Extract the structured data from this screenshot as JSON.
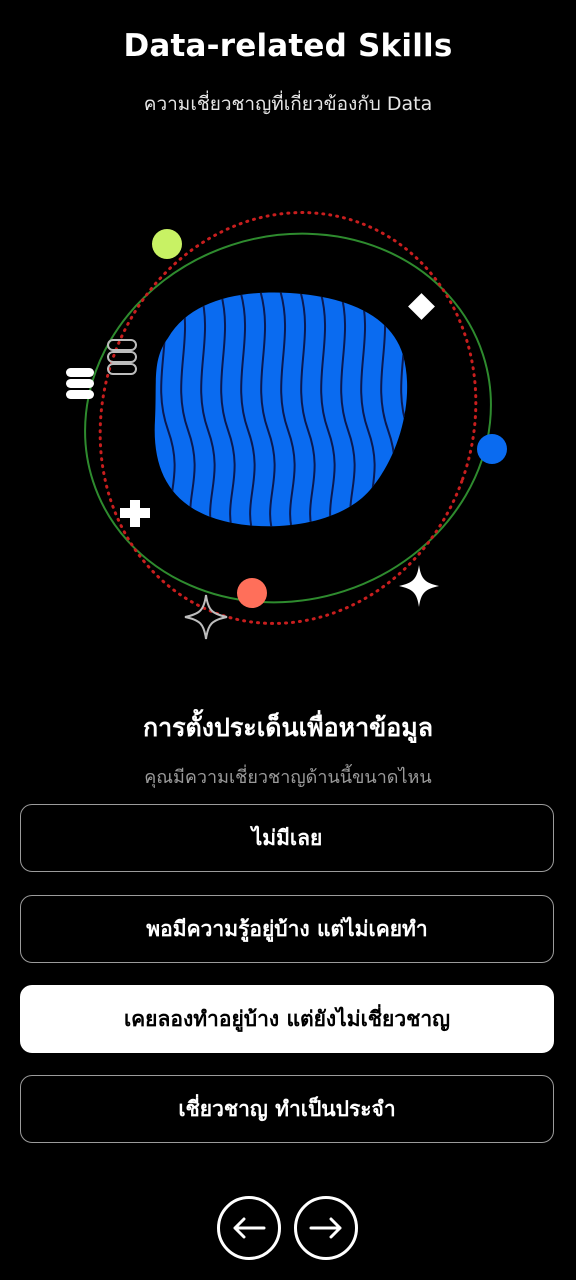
{
  "header": {
    "title": "Data-related Skills",
    "subtitle": "ความเชี่ยวชาญที่เกี่ยวข้องกับ Data"
  },
  "illustration": {
    "icons": [
      "planet-icon",
      "orbit-icon",
      "sparkle-icon",
      "diamond-icon",
      "plus-icon",
      "coil-icon"
    ],
    "colors": {
      "planet": "#0a6bf0",
      "orbit_green": "#2e8b2e",
      "orbit_red": "#c81e1e",
      "dot_lime": "#c8f264",
      "dot_blue": "#0a6bf0",
      "dot_coral": "#ff6f5a"
    }
  },
  "question": {
    "title": "การตั้งประเด็นเพื่อหาข้อมูล",
    "subtitle": "คุณมีความเชี่ยวชาญด้านนี้ขนาดไหน"
  },
  "options": [
    {
      "label": "ไม่มีเลย",
      "selected": false
    },
    {
      "label": "พอมีความรู้อยู่บ้าง แต่ไม่เคยทำ",
      "selected": false
    },
    {
      "label": "เคยลองทำอยู่บ้าง แต่ยังไม่เชี่ยวชาญ",
      "selected": true
    },
    {
      "label": "เชี่ยวชาญ ทำเป็นประจำ",
      "selected": false
    }
  ],
  "navigation": {
    "prev_icon": "arrow-left-icon",
    "next_icon": "arrow-right-icon"
  }
}
